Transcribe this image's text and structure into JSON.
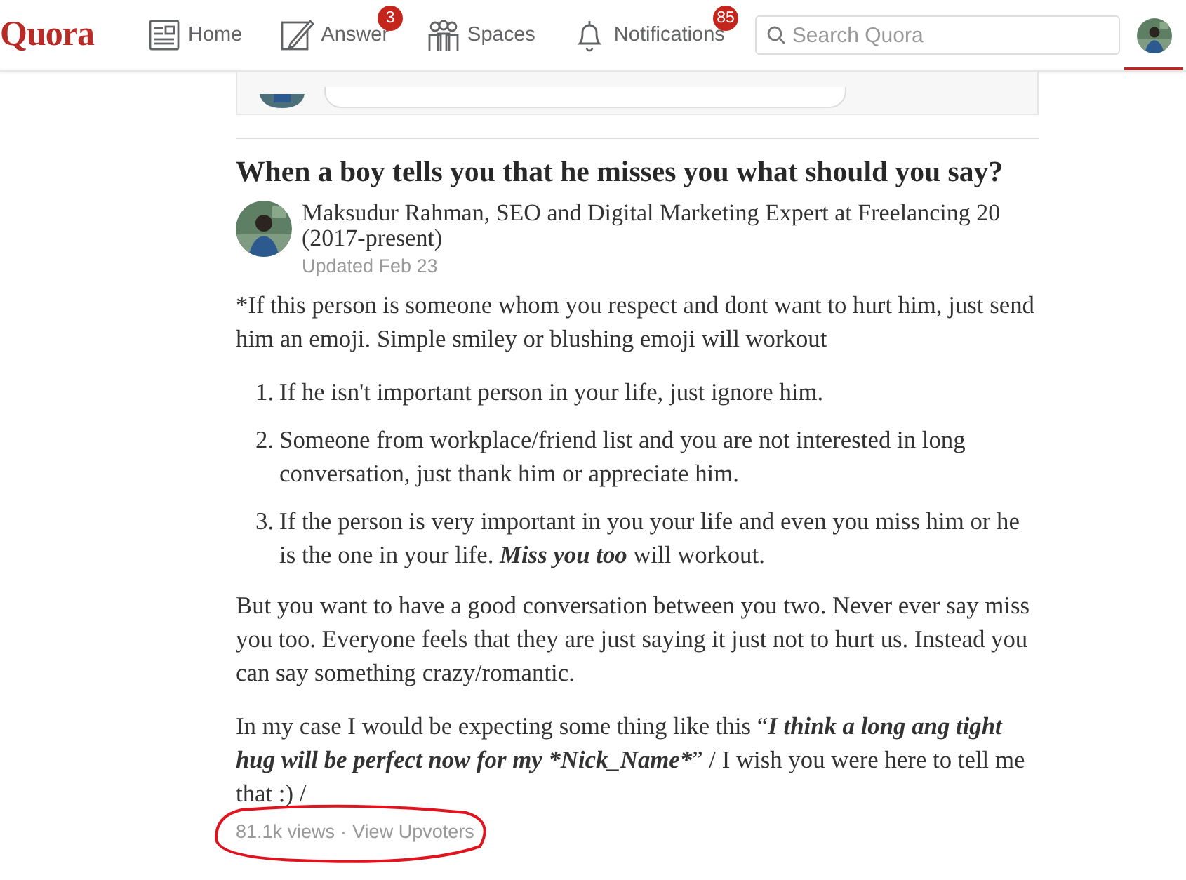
{
  "nav": {
    "logo": "Quora",
    "items": [
      {
        "kind": "home",
        "label": "Home"
      },
      {
        "kind": "answer",
        "label": "Answer",
        "badge": "3"
      },
      {
        "kind": "spaces",
        "label": "Spaces"
      },
      {
        "kind": "notifications",
        "label": "Notifications",
        "badge": "85"
      }
    ],
    "search": {
      "placeholder": "Search Quora"
    },
    "profile": {
      "selected": true
    }
  },
  "question": {
    "title": "When a boy tells you that he misses you what should you say?"
  },
  "author": {
    "credential": "Maksudur Rahman, SEO and Digital Marketing Expert at Freelancing 20 (2017-present)",
    "updated": "Updated Feb 23"
  },
  "body": [
    {
      "kind": "paragraph",
      "segments": [
        {
          "text": "*If this person is someone whom you respect and dont want to hurt him, just send him an emoji. Simple smiley or blushing emoji will workout",
          "emphasis": false
        }
      ]
    },
    {
      "kind": "list",
      "items": [
        {
          "number": "1.",
          "segments": [
            {
              "text": "If he isn't important person in your life, just ignore him.",
              "emphasis": false
            }
          ]
        },
        {
          "number": "2.",
          "segments": [
            {
              "text": "Someone from workplace/friend list and you are not interested in long conversation, just thank him or appreciate him.",
              "emphasis": false
            }
          ]
        },
        {
          "number": "3.",
          "segments": [
            {
              "text": "If the person is very important in you your life and even you miss him or he is the one in your life. ",
              "emphasis": false
            },
            {
              "text": "Miss you too",
              "emphasis": true
            },
            {
              "text": " will workout.",
              "emphasis": false
            }
          ]
        }
      ]
    },
    {
      "kind": "paragraph",
      "segments": [
        {
          "text": "But you want to have a good conversation between you two. Never ever say miss you too. Everyone feels that they are just saying it just not to hurt us. Instead you can say something crazy/romantic.",
          "emphasis": false
        }
      ]
    },
    {
      "kind": "paragraph",
      "segments": [
        {
          "text": "In my case I would be expecting some thing like this “",
          "emphasis": false
        },
        {
          "text": "I think a long ang tight hug will be perfect now for my *Nick_Name*",
          "emphasis": true
        },
        {
          "text": "” / I wish you were here to tell me that :) /",
          "emphasis": false
        }
      ]
    }
  ],
  "footer": {
    "views": "81.1k views",
    "separator": "·",
    "upvoters": "View Upvoters",
    "circled": true
  }
}
